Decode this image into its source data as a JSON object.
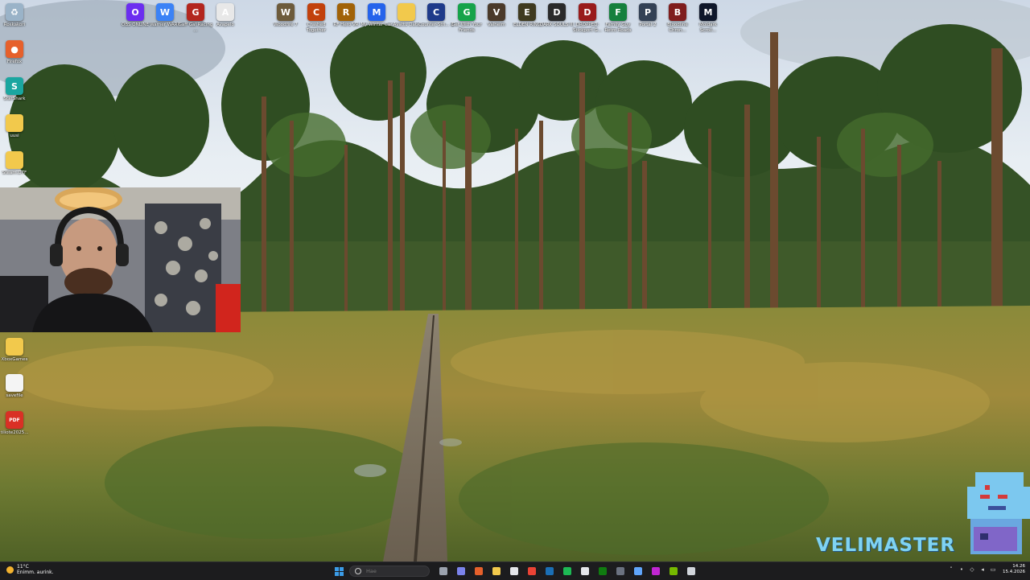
{
  "desktop": {
    "left_icons": [
      {
        "label": "Roskakori",
        "icon": "recycle-bin-icon",
        "color": "#9ab3c8",
        "symbol": "♻"
      },
      {
        "label": "Firefox",
        "icon": "firefox-icon",
        "color": "#e6602b",
        "symbol": "●"
      },
      {
        "label": "StarShark",
        "icon": "app-icon",
        "color": "#1aa6a0",
        "symbol": "S"
      },
      {
        "label": "uusi",
        "icon": "folder-icon",
        "color": "#f2c94c",
        "symbol": ""
      },
      {
        "label": "Steam.DTF",
        "icon": "folder-icon",
        "color": "#f2c94c",
        "symbol": ""
      },
      {
        "label": "XboxGames",
        "icon": "folder-icon",
        "color": "#f2c94c",
        "symbol": ""
      },
      {
        "label": "savefile",
        "icon": "document-icon",
        "color": "#f4f4f4",
        "symbol": ""
      },
      {
        "label": "tiliote2025...",
        "icon": "pdf-icon",
        "color": "#d93025",
        "symbol": "PDF"
      }
    ],
    "top_icons": [
      {
        "label": "OBS ONLINE",
        "icon": "obs-icon",
        "color": "#6b2ef0",
        "symbol": "O"
      },
      {
        "label": "Warner WARP",
        "icon": "app-icon",
        "color": "#3b82f6",
        "symbol": "W"
      },
      {
        "label": "Gaff Gal Racing ...",
        "icon": "game-icon",
        "color": "#b3261e",
        "symbol": "G"
      },
      {
        "label": "Avapelo",
        "icon": "app-icon",
        "color": "#e8e8e8",
        "symbol": "A"
      },
      {
        "label": "Woodfire 7",
        "icon": "game-icon",
        "color": "#6d5b3b",
        "symbol": "W"
      },
      {
        "label": "Crashed Together",
        "icon": "game-icon",
        "color": "#c2410c",
        "symbol": "C"
      },
      {
        "label": "RF Hero VR",
        "icon": "game-icon",
        "color": "#a16207",
        "symbol": "R"
      },
      {
        "label": "My Winter Car",
        "icon": "game-icon",
        "color": "#2563eb",
        "symbol": "M"
      },
      {
        "label": "Avattu Data",
        "icon": "folder-icon",
        "color": "#f2c94c",
        "symbol": ""
      },
      {
        "label": "Counter-Stri... 2",
        "icon": "game-icon",
        "color": "#1e3a8a",
        "symbol": "C"
      },
      {
        "label": "Get With Your Friends",
        "icon": "game-icon",
        "color": "#16a34a",
        "symbol": "G"
      },
      {
        "label": "Valheim",
        "icon": "game-icon",
        "color": "#4b3a2a",
        "symbol": "V"
      },
      {
        "label": "ELDEN RING",
        "icon": "game-icon",
        "color": "#3f3a1f",
        "symbol": "E"
      },
      {
        "label": "DARK SOULS III",
        "icon": "game-icon",
        "color": "#2a2a2a",
        "symbol": "D"
      },
      {
        "label": "DROPPED: Stickport G...",
        "icon": "game-icon",
        "color": "#991b1b",
        "symbol": "D"
      },
      {
        "label": "Family Guy Retro Roads",
        "icon": "game-icon",
        "color": "#15803d",
        "symbol": "F"
      },
      {
        "label": "Portal 2",
        "icon": "game-icon",
        "color": "#334155",
        "symbol": "P"
      },
      {
        "label": "Bloodline Chron...",
        "icon": "game-icon",
        "color": "#7f1d1d",
        "symbol": "B"
      },
      {
        "label": "Moldark Scroll...",
        "icon": "game-icon",
        "color": "#0f172a",
        "symbol": "M"
      }
    ]
  },
  "watermark": {
    "text": "VELIMASTER"
  },
  "taskbar": {
    "weather": {
      "temp": "11°C",
      "condition": "Enimm. aurink."
    },
    "search_placeholder": "Hae",
    "pinned": [
      {
        "icon": "windows-start-icon",
        "color": "#3b9ce8"
      },
      {
        "icon": "task-view-icon",
        "color": "#9ca3af"
      },
      {
        "icon": "teams-icon",
        "color": "#7b83eb"
      },
      {
        "icon": "firefox-icon",
        "color": "#e6602b"
      },
      {
        "icon": "file-explorer-icon",
        "color": "#f2c94c"
      },
      {
        "icon": "store-icon",
        "color": "#e5e7eb"
      },
      {
        "icon": "chrome-icon",
        "color": "#ea4335"
      },
      {
        "icon": "steam-icon",
        "color": "#1b6fb5"
      },
      {
        "icon": "spotify-icon",
        "color": "#1db954"
      },
      {
        "icon": "calculator-icon",
        "color": "#e5e7eb"
      },
      {
        "icon": "xbox-icon",
        "color": "#107c10"
      },
      {
        "icon": "obs-icon",
        "color": "#6b7280"
      },
      {
        "icon": "snipping-icon",
        "color": "#60a5fa"
      },
      {
        "icon": "recording-app-icon",
        "color": "#c026d3"
      },
      {
        "icon": "nvidia-icon",
        "color": "#76b900"
      },
      {
        "icon": "settings-icon",
        "color": "#d1d5db"
      }
    ],
    "tray": [
      {
        "icon": "chevron-up-icon",
        "symbol": "˄"
      },
      {
        "icon": "microphone-icon",
        "symbol": "•"
      },
      {
        "icon": "network-icon",
        "symbol": "◇"
      },
      {
        "icon": "volume-icon",
        "symbol": "◂"
      },
      {
        "icon": "battery-icon",
        "symbol": "▭"
      }
    ],
    "clock": {
      "time": "14.26",
      "date": "15.4.2026"
    }
  }
}
